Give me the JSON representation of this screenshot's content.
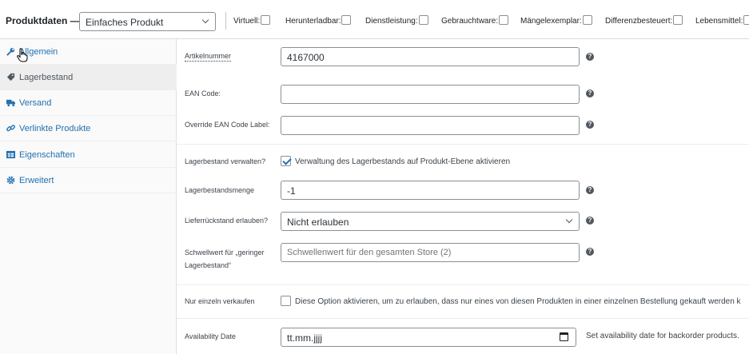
{
  "header": {
    "title": "Produktdaten —",
    "product_type": "Einfaches Produkt",
    "options": [
      {
        "label": "Virtuell:",
        "checked": false
      },
      {
        "label": "Herunterladbar:",
        "checked": false
      },
      {
        "label": "Dienstleistung:",
        "checked": false
      },
      {
        "label": "Gebrauchtware:",
        "checked": false
      },
      {
        "label": "Mängelexemplar:",
        "checked": false
      },
      {
        "label": "Differenzbesteuert:",
        "checked": false
      },
      {
        "label": "Lebensmittel:",
        "checked": false
      }
    ]
  },
  "sidebar": {
    "items": [
      {
        "label": "Allgemein",
        "icon": "wrench-icon",
        "active": false
      },
      {
        "label": "Lagerbestand",
        "icon": "tag-icon",
        "active": true
      },
      {
        "label": "Versand",
        "icon": "truck-icon",
        "active": false
      },
      {
        "label": "Verlinkte Produkte",
        "icon": "link-icon",
        "active": false
      },
      {
        "label": "Eigenschaften",
        "icon": "table-icon",
        "active": false
      },
      {
        "label": "Erweitert",
        "icon": "gear-icon",
        "active": false
      }
    ]
  },
  "fields": {
    "sku": {
      "label": "Artikelnummer",
      "value": "4167000"
    },
    "ean": {
      "label": "EAN Code:",
      "value": ""
    },
    "ean_label": {
      "label": "Override EAN Code Label:",
      "value": ""
    },
    "manage_stock": {
      "label": "Lagerbestand verwalten?",
      "text": "Verwaltung des Lagerbestands auf Produkt-Ebene aktivieren",
      "checked": true
    },
    "stock_qty": {
      "label": "Lagerbestandsmenge",
      "value": "-1"
    },
    "backorders": {
      "label": "Lieferrückstand erlauben?",
      "value": "Nicht erlauben"
    },
    "low_stock": {
      "label_line1": "Schwellwert für „geringer",
      "label_line2": "Lagerbestand“",
      "placeholder": "Schwellenwert für den gesamten Store (2)"
    },
    "sold_individually": {
      "label": "Nur einzeln verkaufen",
      "text": "Diese Option aktivieren, um zu erlauben, dass nur eines von diesen Produkten in einer einzelnen Bestellung gekauft werden k",
      "checked": false
    },
    "availability": {
      "label": "Availability Date",
      "value": "tt.mm.jjjj",
      "note": "Set availability date for backorder products."
    }
  },
  "help_glyph": "?",
  "colors": {
    "link": "#2271b1",
    "active_tab_bg": "#eeeeee",
    "checkmark": "#2271b1"
  }
}
